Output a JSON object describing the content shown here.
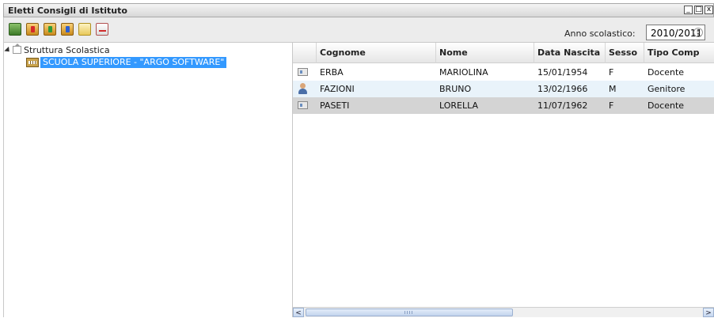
{
  "window": {
    "title": "Eletti Consigli di Istituto",
    "controls": [
      "minimize-icon",
      "maximize-icon",
      "close-icon"
    ]
  },
  "toolbar": {
    "icons": [
      "export-excel-icon",
      "report-red-icon",
      "report-green-icon",
      "report-blue-icon",
      "edit-note-icon",
      "export-pdf-icon"
    ],
    "year_label": "Anno scolastico:",
    "year_value": "2010/2011"
  },
  "tree": {
    "root_label": "Struttura Scolastica",
    "child_label": "SCUOLA SUPERIORE - \"ARGO SOFTWARE\""
  },
  "table": {
    "columns": [
      "Cognome",
      "Nome",
      "Data Nascita",
      "Sesso",
      "Tipo Comp"
    ],
    "rows": [
      {
        "icon": "id-card-icon",
        "cognome": "ERBA",
        "nome": "MARIOLINA",
        "data_nascita": "15/01/1954",
        "sesso": "F",
        "tipo": "Docente"
      },
      {
        "icon": "person-icon",
        "cognome": "FAZIONI",
        "nome": "BRUNO",
        "data_nascita": "13/02/1966",
        "sesso": "M",
        "tipo": "Genitore"
      },
      {
        "icon": "id-card-icon",
        "cognome": "PASETI",
        "nome": "LORELLA",
        "data_nascita": "11/07/1962",
        "sesso": "F",
        "tipo": "Docente"
      }
    ]
  },
  "colors": {
    "selection": "#3399ff",
    "row_alt": "#e9f3fa",
    "row_selected": "#d4d4d4"
  }
}
